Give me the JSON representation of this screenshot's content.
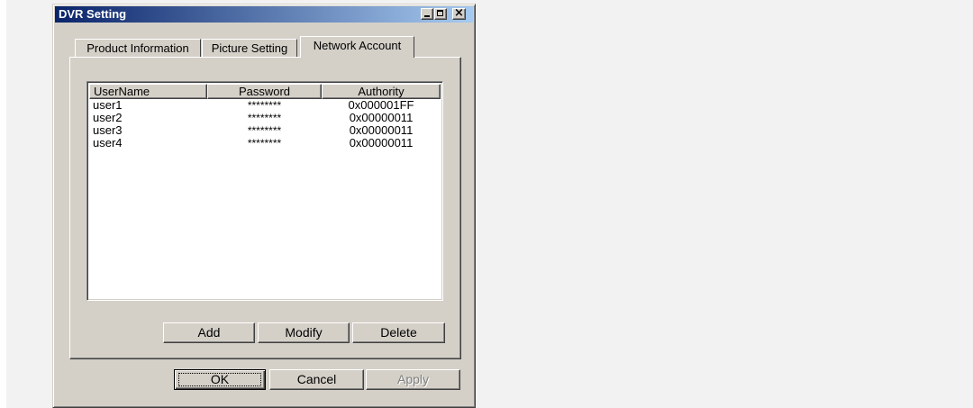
{
  "window": {
    "title": "DVR Setting",
    "controls": {
      "minimize": "minimize-icon",
      "maximize": "maximize-icon",
      "close": "×"
    }
  },
  "tabs": [
    {
      "label": "Product Information",
      "active": false
    },
    {
      "label": "Picture Setting",
      "active": false
    },
    {
      "label": "Network Account",
      "active": true
    }
  ],
  "accounts": {
    "columns": [
      "UserName",
      "Password",
      "Authority"
    ],
    "rows": [
      {
        "username": "user1",
        "password": "********",
        "authority": "0x000001FF"
      },
      {
        "username": "user2",
        "password": "********",
        "authority": "0x00000011"
      },
      {
        "username": "user3",
        "password": "********",
        "authority": "0x00000011"
      },
      {
        "username": "user4",
        "password": "********",
        "authority": "0x00000011"
      }
    ]
  },
  "account_buttons": {
    "add": "Add",
    "modify": "Modify",
    "delete": "Delete"
  },
  "dialog_buttons": {
    "ok": "OK",
    "cancel": "Cancel",
    "apply": "Apply",
    "apply_enabled": false
  },
  "colors": {
    "face": "#d4d0c8",
    "title_start": "#0a246a",
    "title_end": "#a6caf0",
    "disabled_text": "#808080"
  }
}
